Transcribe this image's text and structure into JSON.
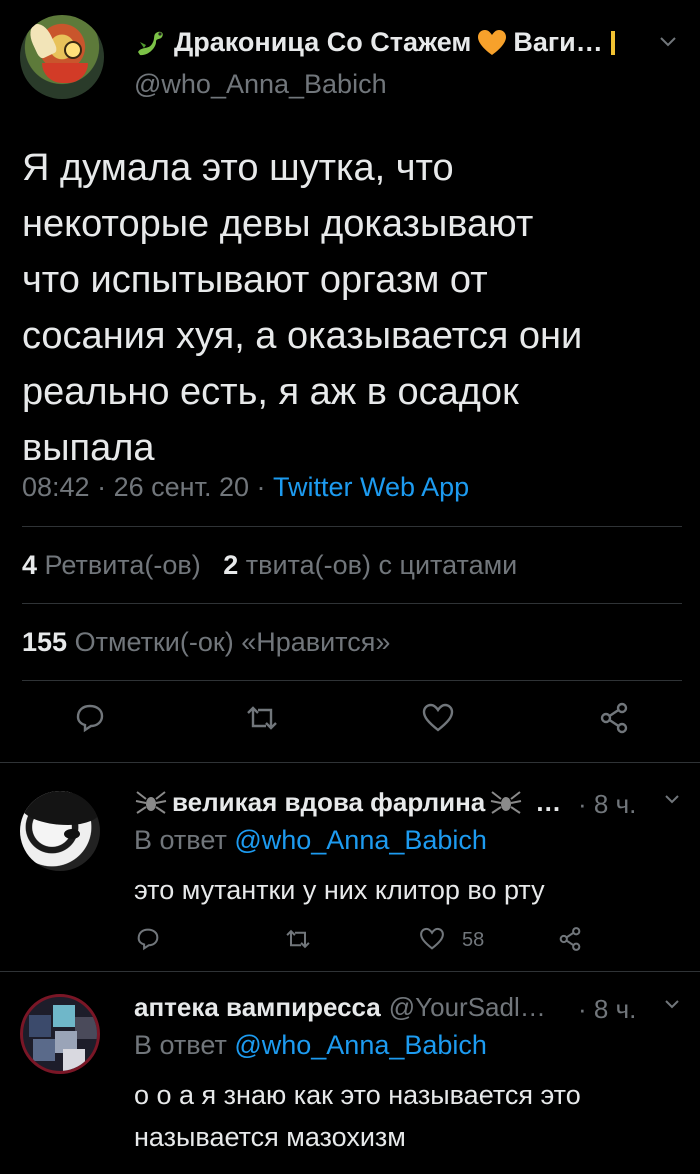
{
  "main_tweet": {
    "display_name": "Драконица Со Стажем",
    "display_name_suffix": "Ваги…",
    "handle": "@who_Anna_Babich",
    "text": "Я думала это шутка, что\nнекоторые девы доказывают\nчто испытывают оргазм от\nсосания хуя, а оказывается они\nреально есть, я аж в осадок\nвыпала",
    "time": "08:42",
    "date": "26 сент. 20",
    "separator": "·",
    "source": "Twitter Web App",
    "retweets_count": "4",
    "retweets_label": "Ретвита(-ов)",
    "quotes_count": "2",
    "quotes_label": "твита(-ов) с цитатами",
    "likes_count": "155",
    "likes_label": "Отметки(-ок) «Нравится»",
    "icons": [
      "dragon-emoji-icon",
      "orange-heart-icon",
      "chevron-down-icon",
      "reply-icon",
      "retweet-icon",
      "like-icon",
      "share-icon"
    ]
  },
  "replies": [
    {
      "display_name": "великая вдова фарлина",
      "ellipsis": "…",
      "handle": "",
      "time": "· 8 ч.",
      "reply_to_label": "В ответ",
      "reply_to_mention": "@who_Anna_Babich",
      "text": "это мутантки у них клитор во рту",
      "likes": "58",
      "icons": [
        "spider-icon",
        "spider-icon",
        "chevron-down-icon"
      ]
    },
    {
      "display_name": "аптека вампиресса",
      "handle": "@YourSadl…",
      "time": "· 8 ч.",
      "reply_to_label": "В ответ",
      "reply_to_mention": "@who_Anna_Babich",
      "text": "о о а я знаю как это называется это называется мазохизм",
      "icons": [
        "chevron-down-icon"
      ]
    }
  ],
  "colors": {
    "background": "#000000",
    "text_primary": "#e7e9ea",
    "text_secondary": "#71767b",
    "accent": "#1d9bf0",
    "divider": "#2f3336"
  }
}
